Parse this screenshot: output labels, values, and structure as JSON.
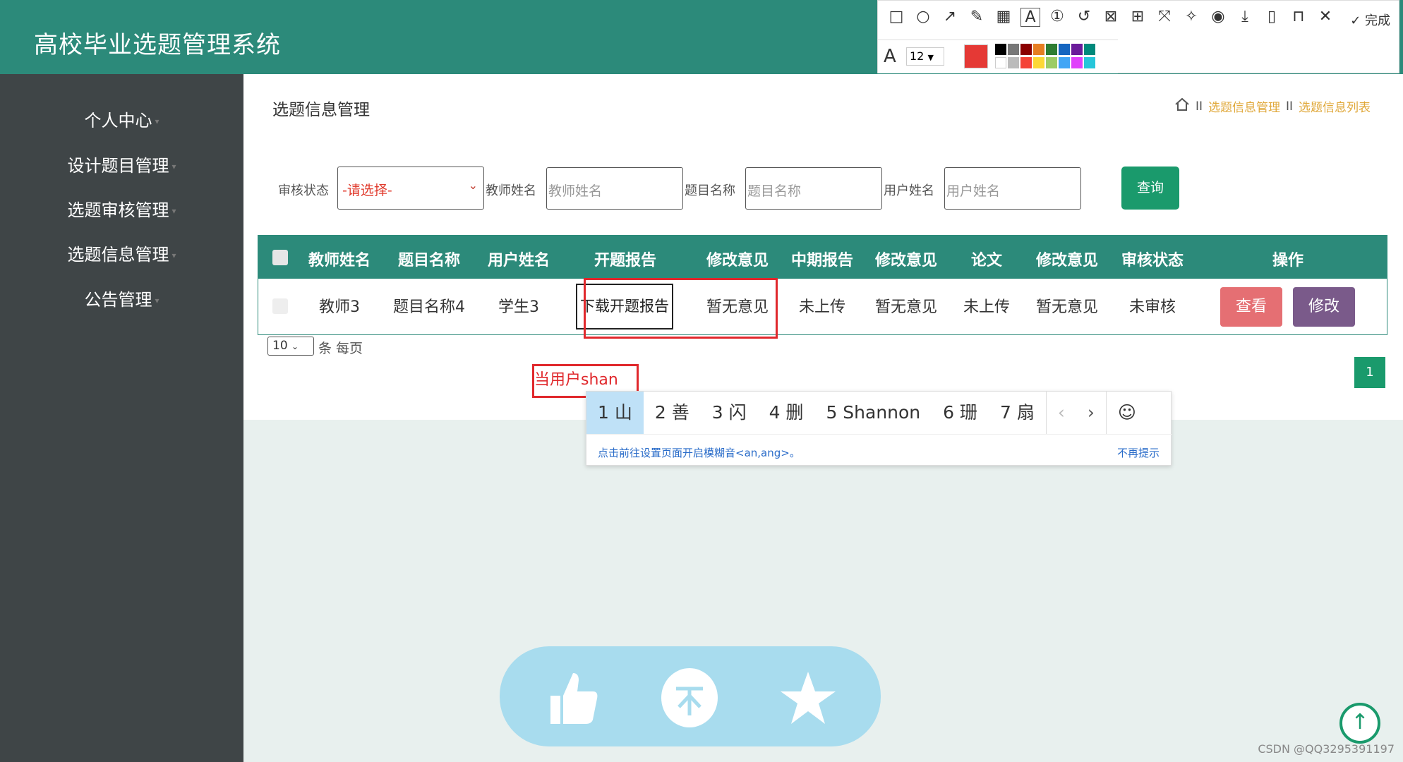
{
  "app": {
    "title": "高校毕业选题管理系统"
  },
  "sidebar": {
    "items": [
      {
        "label": "个人中心"
      },
      {
        "label": "设计题目管理"
      },
      {
        "label": "选题审核管理"
      },
      {
        "label": "选题信息管理"
      },
      {
        "label": "公告管理"
      }
    ]
  },
  "page": {
    "heading": "选题信息管理"
  },
  "breadcrumb": {
    "sep": "II",
    "items": [
      "选题信息管理",
      "选题信息列表"
    ]
  },
  "filters": {
    "status_label": "审核状态",
    "status_value": "-请选择-",
    "teacher_label": "教师姓名",
    "teacher_placeholder": "教师姓名",
    "topic_label": "题目名称",
    "topic_placeholder": "题目名称",
    "user_label": "用户姓名",
    "user_placeholder": "用户姓名",
    "query_label": "查询"
  },
  "table": {
    "columns": [
      "教师姓名",
      "题目名称",
      "用户姓名",
      "开题报告",
      "修改意见",
      "中期报告",
      "修改意见",
      "论文",
      "修改意见",
      "审核状态",
      "操作"
    ],
    "rows": [
      {
        "teacher": "教师3",
        "topic": "题目名称4",
        "user": "学生3",
        "proposal": "下载开题报告",
        "opinion1": "暂无意见",
        "midterm": "未上传",
        "opinion2": "暂无意见",
        "thesis": "未上传",
        "opinion3": "暂无意见",
        "status": "未审核",
        "view": "查看",
        "edit": "修改"
      }
    ]
  },
  "pagination": {
    "per_page": "10",
    "per_page_label": "条 每页",
    "current": "1"
  },
  "annotation": {
    "text": "当用户shan"
  },
  "ime": {
    "candidates": [
      "1 山",
      "2 善",
      "3 闪",
      "4 删",
      "5 Shannon",
      "6 珊",
      "7 扇"
    ],
    "tip": "点击前往设置页面开启模糊音<an,ang>。",
    "skip": "不再提示"
  },
  "toolbar": {
    "done": "完成",
    "font_size": "12",
    "font_glyph": "A"
  },
  "colors": {
    "header": "#2c8a7a",
    "sidebar": "#3f4547",
    "view_btn": "#e56f73",
    "edit_btn": "#7a5a8a",
    "query_btn": "#1a9a6c",
    "annotation": "#e0282c"
  },
  "watermark": "CSDN @QQ3295391197"
}
